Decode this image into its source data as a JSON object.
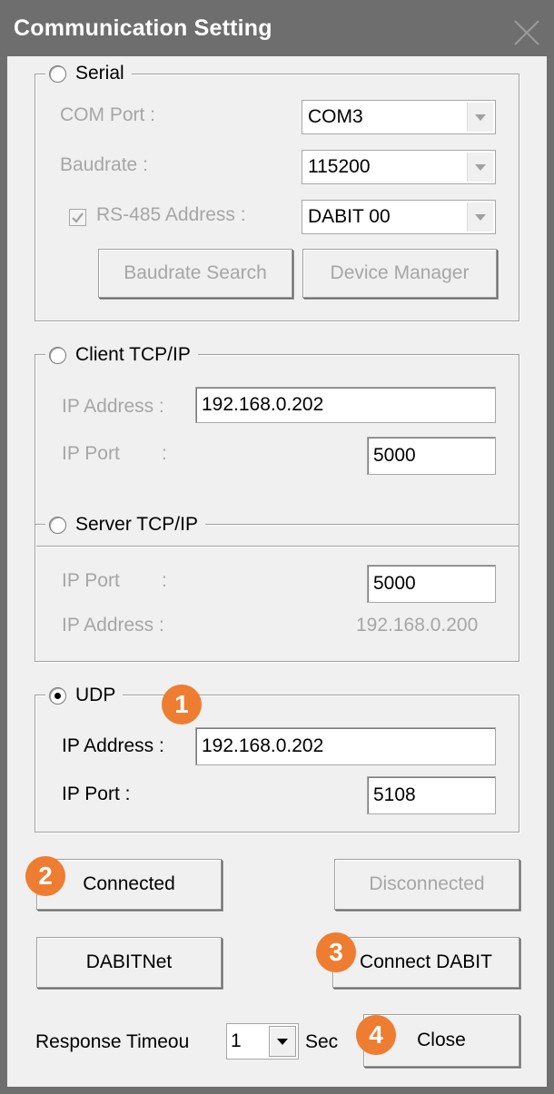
{
  "window": {
    "title": "Communication Setting"
  },
  "serial": {
    "label": "Serial",
    "com_port_label": "COM Port :",
    "com_port_value": "COM3",
    "baudrate_label": "Baudrate  :",
    "baudrate_value": "115200",
    "rs485_label": "RS-485 Address :",
    "rs485_value": "DABIT 00",
    "baudrate_search": "Baudrate Search",
    "device_manager": "Device Manager"
  },
  "client_tcp": {
    "label": "Client TCP/IP",
    "ip_address_label": "IP Address :",
    "ip_address_value": "192.168.0.202",
    "ip_port_label": "IP Port",
    "ip_port_colon": ":",
    "ip_port_value": "5000"
  },
  "server_tcp": {
    "label": "Server TCP/IP",
    "ip_port_label": "IP Port",
    "ip_port_colon": ":",
    "ip_port_value": "5000",
    "ip_address_label": "IP Address :",
    "ip_address_value": "192.168.0.200"
  },
  "udp": {
    "label": "UDP",
    "ip_address_label": "IP Address :",
    "ip_address_value": "192.168.0.202",
    "ip_port_label": "IP Port :",
    "ip_port_value": "5108"
  },
  "buttons": {
    "connected": "Connected",
    "disconnected": "Disconnected",
    "dabitnet": "DABITNet",
    "connect_dabit": "Connect DABIT",
    "close": "Close"
  },
  "timeout": {
    "label": "Response Timeou",
    "value": "1",
    "unit": "Sec"
  },
  "badges": [
    "1",
    "2",
    "3",
    "4"
  ],
  "colors": {
    "badge": "#ee7d31",
    "title_bar": "#6e6e6e",
    "disabled_text": "#a6a6a6"
  }
}
